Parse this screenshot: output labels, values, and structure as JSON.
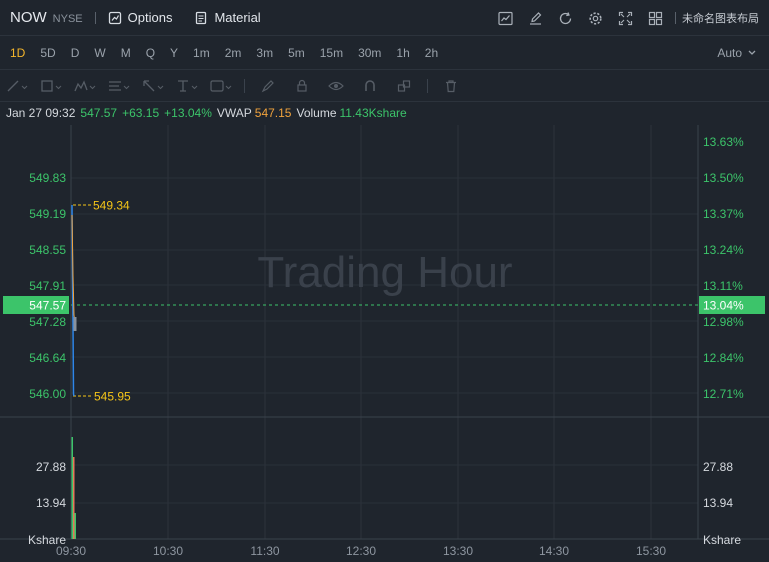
{
  "header": {
    "symbol": "NOW",
    "exchange": "NYSE",
    "options_label": "Options",
    "material_label": "Material",
    "layout_label": "未命名图表布局",
    "icons": [
      "chart-icon",
      "edit-icon",
      "refresh-icon",
      "settings-icon",
      "fullscreen-icon",
      "grid-icon"
    ]
  },
  "periods": {
    "items": [
      "1D",
      "5D",
      "D",
      "W",
      "M",
      "Q",
      "Y",
      "1m",
      "2m",
      "3m",
      "5m",
      "15m",
      "30m",
      "1h",
      "2h"
    ],
    "active": "1D",
    "scale_mode": "Auto"
  },
  "info": {
    "datetime": "Jan 27 09:32",
    "price": "547.57",
    "change": "+63.15",
    "change_pct": "+13.04%",
    "vwap_label": "VWAP",
    "vwap": "547.15",
    "volume_label": "Volume",
    "volume": "11.43Kshare"
  },
  "chart": {
    "watermark": "Trading Hour",
    "left_prices": [
      "549.83",
      "549.19",
      "548.55",
      "547.91",
      "547.28",
      "546.64",
      "546.00"
    ],
    "right_pcts": [
      "13.63%",
      "13.50%",
      "13.37%",
      "13.24%",
      "13.11%",
      "12.98%",
      "12.84%",
      "12.71%"
    ],
    "current_price": "547.57",
    "current_pct": "13.04%",
    "high_mark": "549.34",
    "low_mark": "545.95",
    "volume_left": [
      "27.88",
      "13.94",
      "Kshare"
    ],
    "volume_right": [
      "27.88",
      "13.94",
      "Kshare"
    ],
    "time_labels": [
      "09:30",
      "10:30",
      "11:30",
      "12:30",
      "13:30",
      "14:30",
      "15:30"
    ]
  },
  "colors": {
    "background": "#1f252d",
    "up": "#3cc46a",
    "accent": "#f5b62b",
    "vwap": "#f0a23c",
    "price_line": "#2e86e8",
    "marker": "#f5c518"
  }
}
